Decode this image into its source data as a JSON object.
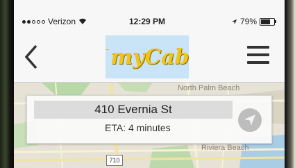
{
  "status_bar": {
    "carrier": "Verizon",
    "time": "12:29 PM",
    "battery": "79%",
    "battery_level": 0.79
  },
  "nav": {
    "back_icon": "chevron-left-icon",
    "logo_text": "myCab",
    "menu_icon": "hamburger-menu-icon"
  },
  "map": {
    "labels": {
      "north_palm_beach": "North Palm Beach",
      "riviera_beach": "Riviera Beach"
    },
    "route_shield": "710"
  },
  "destination": {
    "address": "410 Evernia St",
    "eta": "ETA: 4 minutes",
    "locate_icon": "navigation-arrow-icon"
  },
  "colors": {
    "logo_bg": "#c9e3f7",
    "logo_text": "#f0c419"
  }
}
